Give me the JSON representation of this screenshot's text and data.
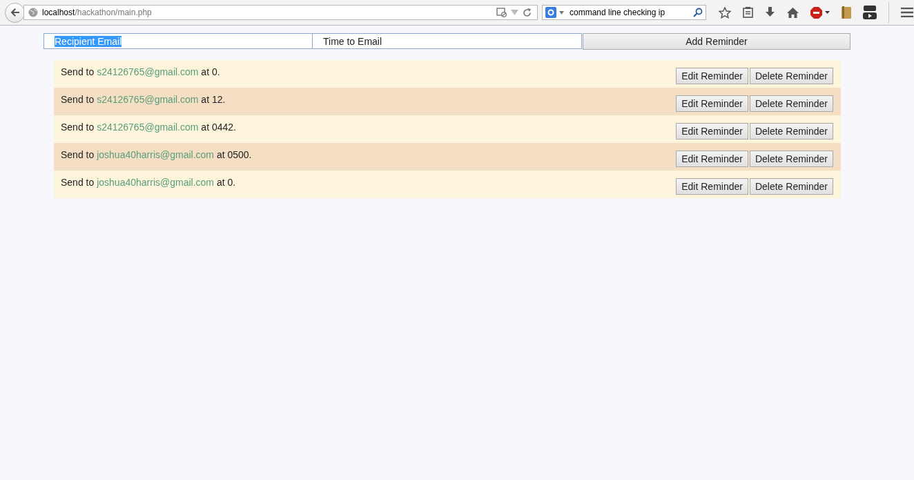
{
  "browser": {
    "url_host": "localhost",
    "url_path": "/hackathon/main.php",
    "search_value": "command line checking ip"
  },
  "form": {
    "recipient": {
      "value": "Recipient Email",
      "text_selected": true
    },
    "time": {
      "value": "Time to Email"
    },
    "add_button": "Add Reminder"
  },
  "reminders": [
    {
      "prefix": "Send to",
      "email": "s24126765@gmail.com",
      "suffix": "at 0.",
      "edit": "Edit Reminder",
      "delete": "Delete Reminder"
    },
    {
      "prefix": "Send to",
      "email": "s24126765@gmail.com",
      "suffix": "at 12.",
      "edit": "Edit Reminder",
      "delete": "Delete Reminder"
    },
    {
      "prefix": "Send to",
      "email": "s24126765@gmail.com",
      "suffix": "at 0442.",
      "edit": "Edit Reminder",
      "delete": "Delete Reminder"
    },
    {
      "prefix": "Send to",
      "email": "joshua40harris@gmail.com",
      "suffix": "at 0500.",
      "edit": "Edit Reminder",
      "delete": "Delete Reminder"
    },
    {
      "prefix": "Send to",
      "email": "joshua40harris@gmail.com",
      "suffix": "at 0.",
      "edit": "Edit Reminder",
      "delete": "Delete Reminder"
    }
  ]
}
